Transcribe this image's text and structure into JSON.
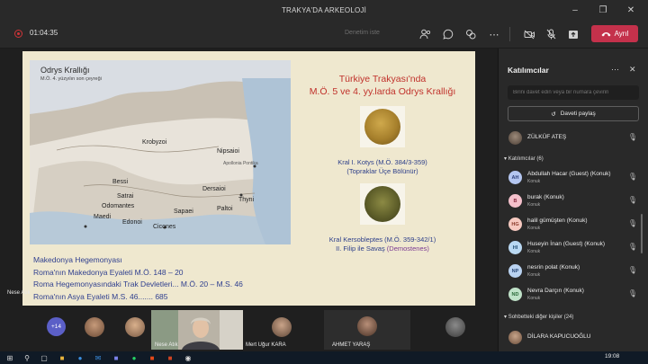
{
  "window": {
    "title": "TRAKYA'DA ARKEOLOJİ"
  },
  "toolbar": {
    "timer": "01:04:35",
    "hint": "Denetim iste",
    "leave_label": "Ayrıl"
  },
  "slide": {
    "map_title": "Odrys Krallığı",
    "map_subtitle": "M.Ö. 4. yüzyılın son çeyreği",
    "map_labels": [
      "Krobyzoi",
      "Nipsaioi",
      "Bessi",
      "Satrai",
      "Odomantes",
      "Maedi",
      "Edonoi",
      "Dersaioi",
      "Sapaei",
      "Paltoi",
      "Thyni",
      "Cicones",
      "Apollonia Pontika"
    ],
    "heading_line1": "Türkiye Trakyası'nda",
    "heading_line2": "M.Ö. 5 ve 4. yy.larda Odrys Krallığı",
    "coin1_caption_line1": "Kral I. Kotys (M.Ö. 384/3-359)",
    "coin1_caption_line2": "(Topraklar Üçe Bölünür)",
    "coin2_caption_line1": "Kral Kersobleptes (M.Ö. 359-342/1)",
    "coin2_caption_line2_a": "II. Filip ile Savaş",
    "coin2_caption_line2_b": "(Demostenes)",
    "bottom_lines": [
      "Makedonya Hegemonyası",
      "Roma'nın Makedonya Eyaleti M.Ö. 148 – 20",
      "Roma Hegemonyasındaki Trak Devletleri... M.Ö. 20 – M.S. 46",
      "Roma'nın Asya Eyaleti M.S. 46....... 685"
    ],
    "presenter_name": "Nese Atık"
  },
  "strip": {
    "more_count": "+14",
    "tiles": [
      {
        "name": "Nese Atık"
      },
      {
        "name": "Mert Uğur KARA"
      },
      {
        "name": "AHMET YARAŞ"
      }
    ]
  },
  "panel": {
    "title": "Katılımcılar",
    "invite_placeholder": "Birini davet edin veya bir numara çevirin",
    "share_label": "Daveti paylaş",
    "organizer": {
      "name": "ZÜLKÜF ATEŞ"
    },
    "attendees_section": "Katılımcılar (6)",
    "attendees": [
      {
        "initials": "AH",
        "name": "Abdullah Hacar (Guest) (Konuk)",
        "role": "Konuk",
        "color": "#b4c6f0",
        "fg": "#2c3f7a"
      },
      {
        "initials": "B",
        "name": "burak (Konuk)",
        "role": "Konuk",
        "color": "#f4c0cb",
        "fg": "#8a2a40"
      },
      {
        "initials": "HG",
        "name": "halil gümüşten (Konuk)",
        "role": "Konuk",
        "color": "#f6c9c0",
        "fg": "#8a3a2a"
      },
      {
        "initials": "HI",
        "name": "Huseyin İnan (Guest) (Konuk)",
        "role": "Konuk",
        "color": "#b9d8f2",
        "fg": "#244f75"
      },
      {
        "initials": "NP",
        "name": "nesrin polat (Konuk)",
        "role": "Konuk",
        "color": "#b9d2f0",
        "fg": "#2a4a78"
      },
      {
        "initials": "ND",
        "name": "Nevra Darçın (Konuk)",
        "role": "Konuk",
        "color": "#bfe2c8",
        "fg": "#2b6a3a"
      }
    ],
    "others_section": "Sohbetteki diğer kişiler (24)",
    "others_first": {
      "name": "DİLARA KAPUCUOĞLU"
    }
  },
  "taskbar": {
    "time": "19:08"
  }
}
